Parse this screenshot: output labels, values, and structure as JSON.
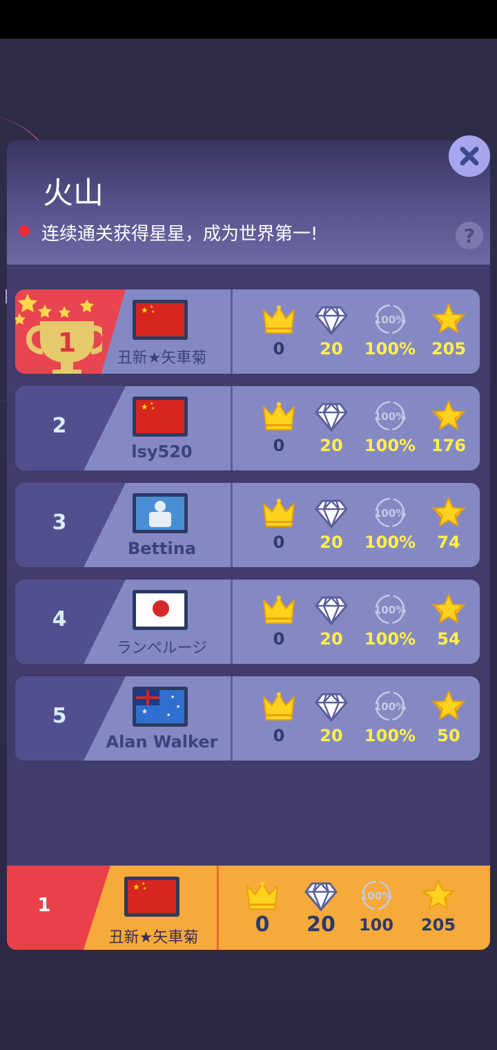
{
  "header": {
    "title": "火山",
    "subtitle": "连续通关获得星星，成为世界第一!",
    "help_label": "?"
  },
  "colors": {
    "first_rank": "#e84550",
    "row_bg": "#8489c4",
    "value_yellow": "#fff04a",
    "my_row_bg": "#f5aa3a"
  },
  "icons": [
    "crown-icon",
    "diamond-icon",
    "percent-100-icon",
    "winged-star-icon",
    "trophy-icon",
    "close-icon",
    "help-icon"
  ],
  "leaderboard": [
    {
      "rank": "1",
      "flag": "china",
      "name": "丑新★矢車菊",
      "crowns": "0",
      "diamonds": "20",
      "percent": "100%",
      "stars": "205"
    },
    {
      "rank": "2",
      "flag": "china",
      "name": "lsy520",
      "crowns": "0",
      "diamonds": "20",
      "percent": "100%",
      "stars": "176"
    },
    {
      "rank": "3",
      "flag": "avatar",
      "name": "Bettina",
      "crowns": "0",
      "diamonds": "20",
      "percent": "100%",
      "stars": "74"
    },
    {
      "rank": "4",
      "flag": "japan",
      "name": "ランペルージ",
      "crowns": "0",
      "diamonds": "20",
      "percent": "100%",
      "stars": "54"
    },
    {
      "rank": "5",
      "flag": "australia",
      "name": "Alan Walker",
      "crowns": "0",
      "diamonds": "20",
      "percent": "100%",
      "stars": "50"
    }
  ],
  "me": {
    "rank": "1",
    "flag": "china",
    "name": "丑新★矢車菊",
    "crowns": "0",
    "diamonds": "20",
    "percent": "100",
    "stars": "205"
  }
}
